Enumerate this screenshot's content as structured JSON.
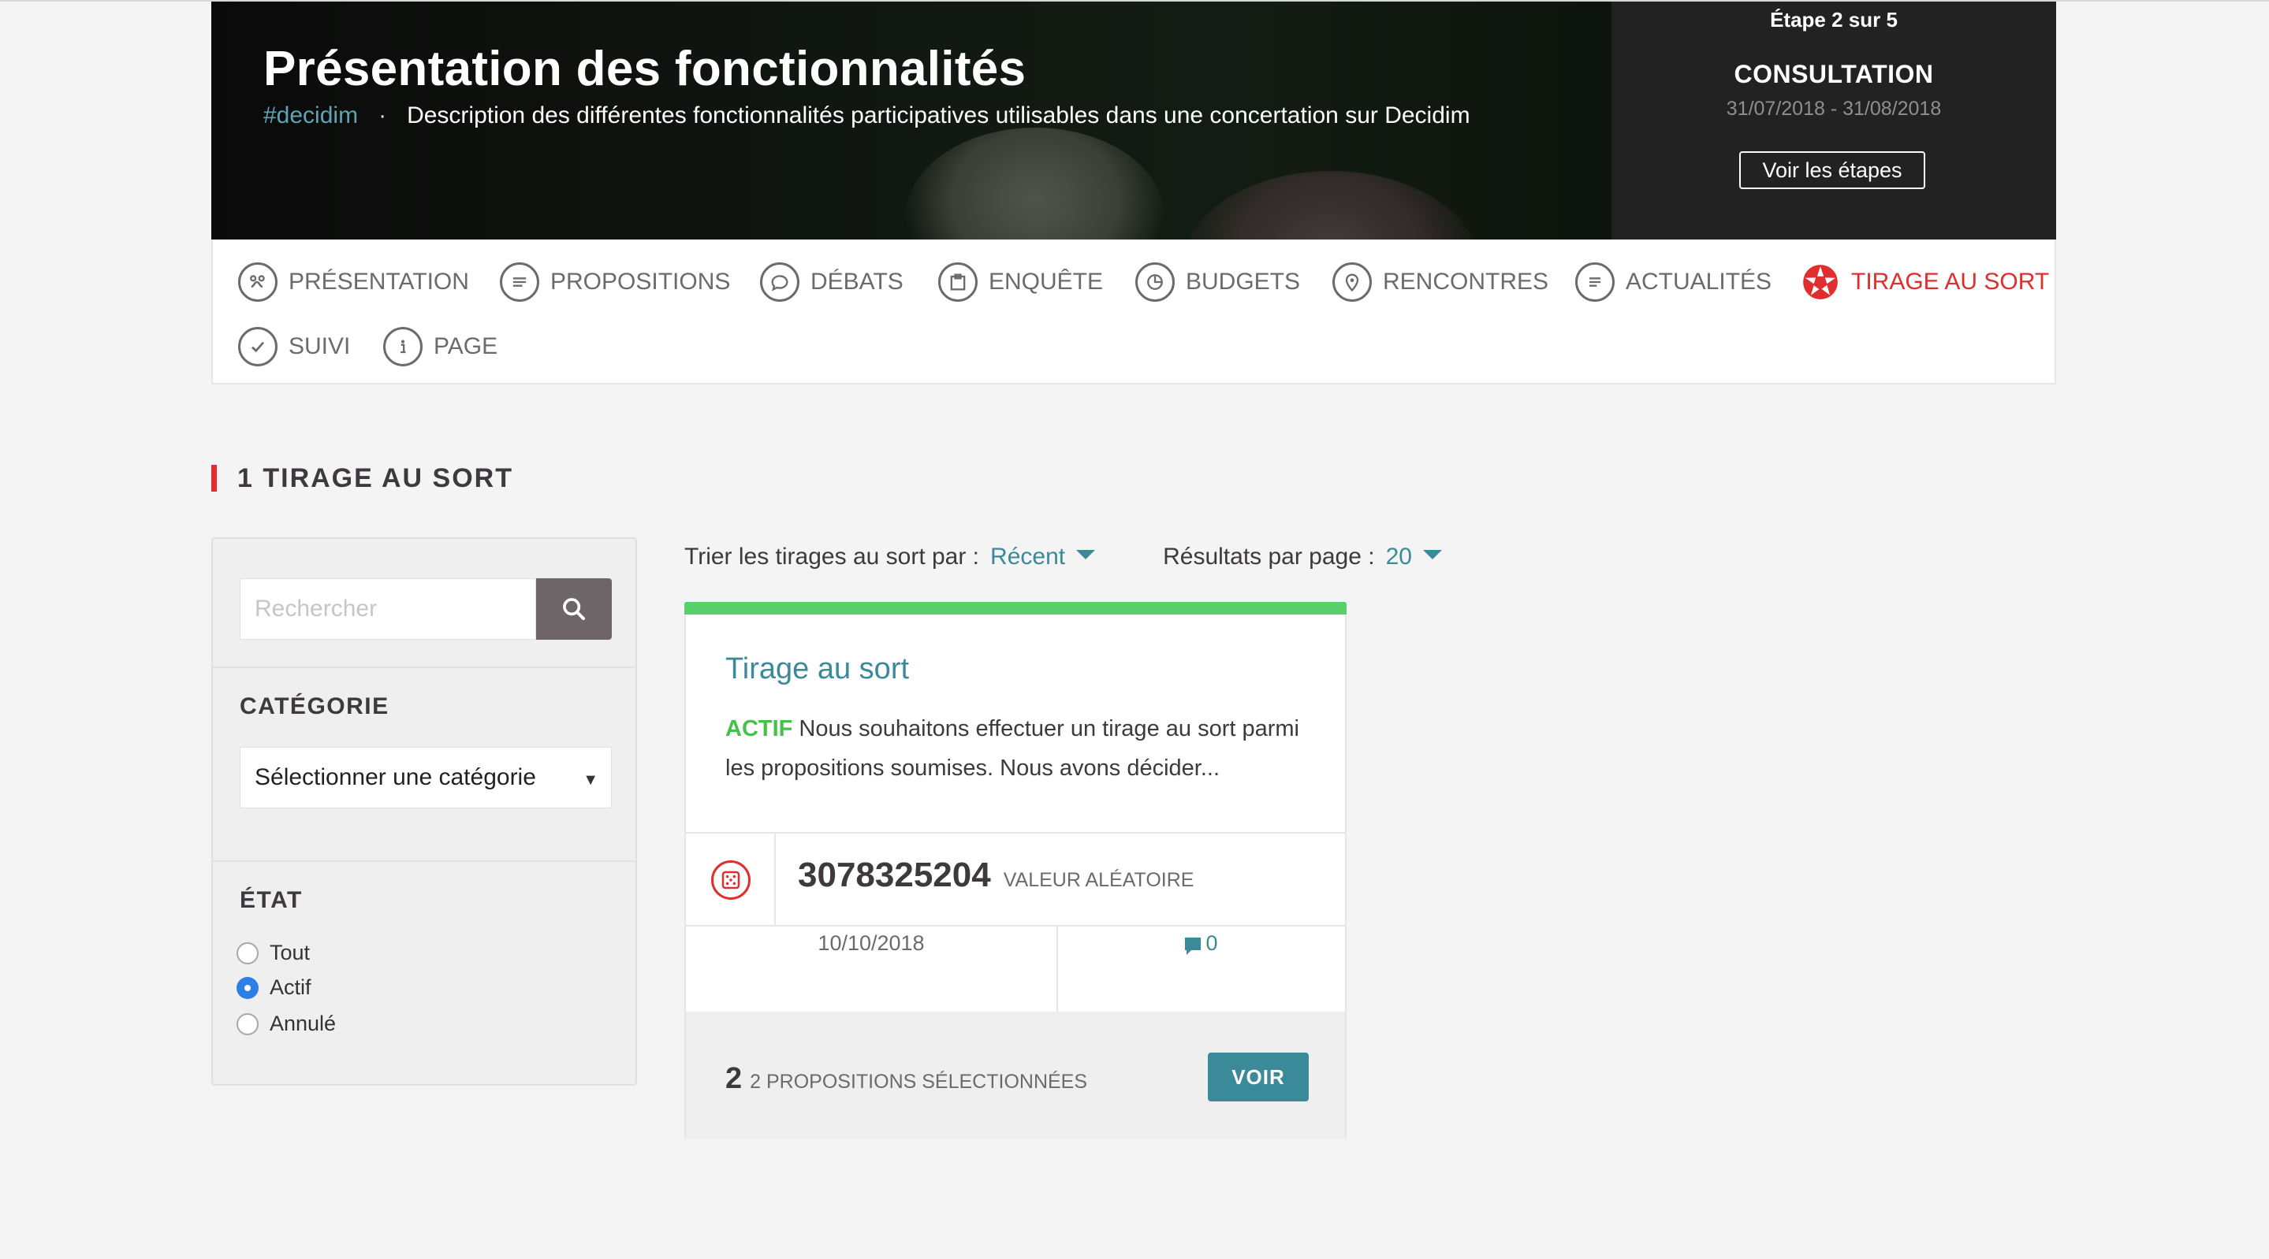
{
  "hero": {
    "title": "Présentation des fonctionnalités",
    "hashtag": "#decidim",
    "separator": "·",
    "description": "Description des différentes fonctionnalités participatives utilisables dans une concertation sur Decidim"
  },
  "step": {
    "counter": "Étape 2 sur 5",
    "phase": "CONSULTATION",
    "dates": "31/07/2018 - 31/08/2018",
    "button_label": "Voir les étapes"
  },
  "tabs": [
    {
      "label": "Présentation",
      "icon": "presentation-icon"
    },
    {
      "label": "Propositions",
      "icon": "proposals-icon"
    },
    {
      "label": "Débats",
      "icon": "debates-icon"
    },
    {
      "label": "Enquête",
      "icon": "survey-icon"
    },
    {
      "label": "Budgets",
      "icon": "budgets-icon"
    },
    {
      "label": "Rencontres",
      "icon": "meetings-icon"
    },
    {
      "label": "Actualités",
      "icon": "news-icon"
    },
    {
      "label": "Tirage au sort",
      "icon": "sortition-icon",
      "active": true
    },
    {
      "label": "Suivi",
      "icon": "check-icon"
    },
    {
      "label": "Page",
      "icon": "info-icon"
    }
  ],
  "section": {
    "title": "1 TIRAGE AU SORT"
  },
  "filters": {
    "search_placeholder": "Rechercher",
    "category_label": "CATÉGORIE",
    "category_value": "Sélectionner une catégorie",
    "state_label": "ÉTAT",
    "state_options": [
      {
        "label": "Tout",
        "checked": false
      },
      {
        "label": "Actif",
        "checked": true
      },
      {
        "label": "Annulé",
        "checked": false
      }
    ]
  },
  "sort": {
    "order_label": "Trier les tirages au sort par :",
    "order_value": "Récent",
    "per_page_label": "Résultats par page :",
    "per_page_value": "20"
  },
  "card": {
    "title": "Tirage au sort",
    "status": "ACTIF",
    "description": "Nous souhaitons effectuer un tirage au sort parmi les propositions soumises. Nous avons décider...",
    "seed": "3078325204",
    "seed_label": "VALEUR ALÉATOIRE",
    "date": "10/10/2018",
    "comments": "0",
    "selected_count": "2",
    "selected_label": "2 PROPOSITIONS SÉLECTIONNÉES",
    "button_label": "VOIR"
  },
  "colors": {
    "accent": "#e02d2d",
    "link": "#3b8a9a",
    "active_status": "#45c14a",
    "progress_bar": "#57d06b"
  }
}
